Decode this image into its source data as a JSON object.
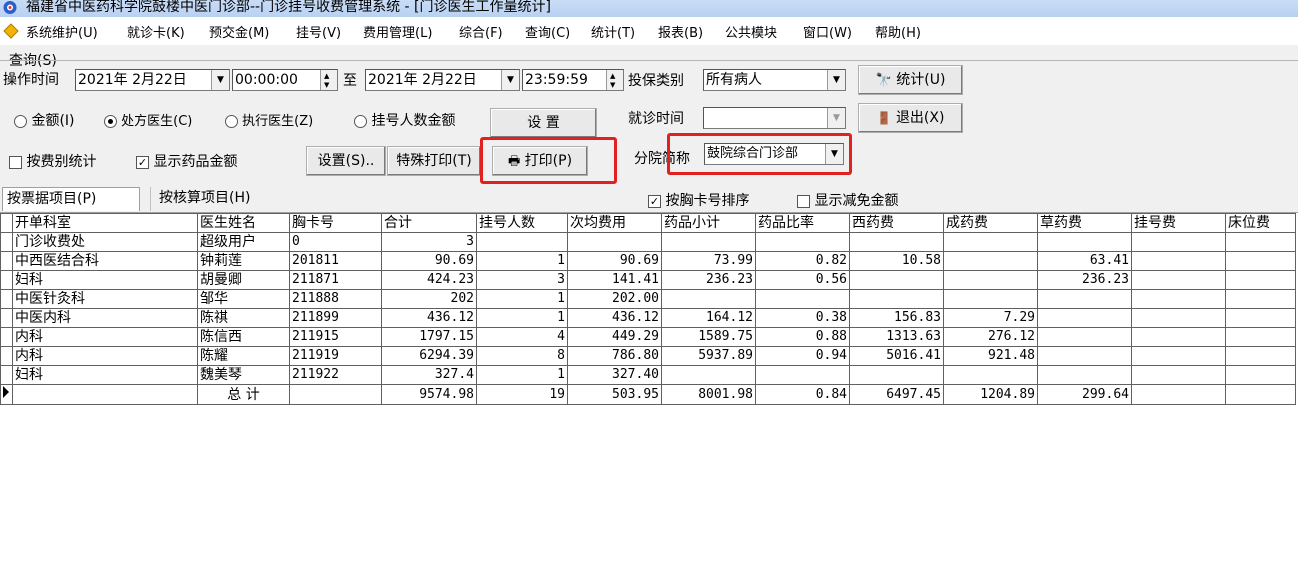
{
  "window": {
    "title": "福建省中医药科学院鼓楼中医门诊部--门诊挂号收费管理系统 - [门诊医生工作量统计]"
  },
  "menu": [
    "系统维护(U)",
    "就诊卡(K)",
    "预交金(M)",
    "挂号(V)",
    "费用管理(L)",
    "综合(F)",
    "查询(C)",
    "统计(T)",
    "报表(B)",
    "公共模块",
    "窗口(W)",
    "帮助(H)"
  ],
  "query": {
    "group_label": "查询(S)",
    "op_time_label": "操作时间",
    "start_date": "2021年 2月22日",
    "start_time": "00:00:00",
    "to_label": "至",
    "end_date": "2021年 2月22日",
    "end_time": "23:59:59",
    "insure_label": "投保类别",
    "insure_value": "所有病人",
    "stat_button": "统计(U)",
    "exit_button": "退出(X)",
    "radios": [
      "金额(I)",
      "处方医生(C)",
      "执行医生(Z)",
      "挂号人数金额"
    ],
    "setup_button": "设 置",
    "visit_time_label": "就诊时间",
    "visit_time_value": "",
    "chk_by_fee": "按费别统计",
    "chk_show_drug": "显示药品金额",
    "settings_button": "设置(S)..",
    "special_print_button": "特殊打印(T)",
    "print_button": "打印(P)",
    "branch_label": "分院简称",
    "branch_value": "鼓院综合门诊部"
  },
  "tabs": {
    "by_receipt": "按票据项目(P)",
    "by_settle": "按核算项目(H)"
  },
  "options": {
    "sort_by_card": "按胸卡号排序",
    "show_discount": "显示减免金额"
  },
  "table": {
    "columns": [
      "开单科室",
      "医生姓名",
      "胸卡号",
      "合计",
      "挂号人数",
      "次均费用",
      "药品小计",
      "药品比率",
      "西药费",
      "成药费",
      "草药费",
      "挂号费",
      "床位费"
    ],
    "rows": [
      [
        "门诊收费处",
        "超级用户",
        "0",
        "3",
        "",
        "",
        "",
        "",
        "",
        "",
        "",
        "",
        ""
      ],
      [
        "中西医结合科",
        "钟莉莲",
        "201811",
        "90.69",
        "1",
        "90.69",
        "73.99",
        "0.82",
        "10.58",
        "",
        "63.41",
        "",
        ""
      ],
      [
        "妇科",
        "胡曼卿",
        "211871",
        "424.23",
        "3",
        "141.41",
        "236.23",
        "0.56",
        "",
        "",
        "236.23",
        "",
        ""
      ],
      [
        "中医针灸科",
        "邹华",
        "211888",
        "202",
        "1",
        "202.00",
        "",
        "",
        "",
        "",
        "",
        "",
        ""
      ],
      [
        "中医内科",
        "陈祺",
        "211899",
        "436.12",
        "1",
        "436.12",
        "164.12",
        "0.38",
        "156.83",
        "7.29",
        "",
        "",
        ""
      ],
      [
        "内科",
        "陈信西",
        "211915",
        "1797.15",
        "4",
        "449.29",
        "1589.75",
        "0.88",
        "1313.63",
        "276.12",
        "",
        "",
        ""
      ],
      [
        "内科",
        "陈耀",
        "211919",
        "6294.39",
        "8",
        "786.80",
        "5937.89",
        "0.94",
        "5016.41",
        "921.48",
        "",
        "",
        ""
      ],
      [
        "妇科",
        "魏美琴",
        "211922",
        "327.4",
        "1",
        "327.40",
        "",
        "",
        "",
        "",
        "",
        "",
        ""
      ]
    ],
    "total": [
      "",
      "总 计",
      "",
      "9574.98",
      "19",
      "503.95",
      "8001.98",
      "0.84",
      "6497.45",
      "1204.89",
      "299.64",
      "",
      ""
    ]
  },
  "colors": {
    "highlight": "#e32020",
    "titlebar": "#c8dcf6",
    "panel": "#f0f0f0"
  }
}
